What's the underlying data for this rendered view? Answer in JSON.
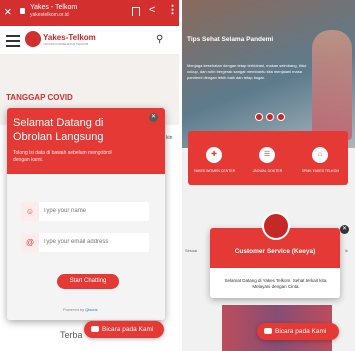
{
  "left": {
    "browser": {
      "close": "×",
      "title": "Yakes - Telkom",
      "url": "yakestelkom.or.id",
      "share": "<",
      "menu": "⋮"
    },
    "site": {
      "logo_text": "Yakes-Telkom",
      "logo_sub": "YAYASAN KESEHATAN TELKOM",
      "search": "⚲"
    },
    "hero": {
      "title": "TANGGAP COVID",
      "side": "kin"
    },
    "chat": {
      "title": "Selamat Datang di Obrolan Langsung",
      "subtitle": "Tolong isi data di bawah sebelum mengobrol dengan kami.",
      "close": "✕",
      "name_placeholder": "Type your name",
      "email_placeholder": "Type your email address",
      "start_button": "Start Chatting",
      "powered_prefix": "Powered by",
      "powered_brand": "Qiscus"
    },
    "page_word": "Terba",
    "float_button": "Bicara pada Kami"
  },
  "right": {
    "slide_title": "Tips Sehat Selama Pandemi",
    "slide_text": "Menjaga kesehatan dengan tetap terhidrasi, makan seimbang, tidur cukup, dan rutin bergerak sangat membantu kita menjalani masa pandemi dengan lebih baik dan tetap bugar.",
    "services": [
      {
        "icon": "✚",
        "label": "YAKES WOMEN CENTER"
      },
      {
        "icon": "☰",
        "label": "JADWAL DOKTER"
      },
      {
        "icon": "⌂",
        "label": "SPMK YAKES TELKOM"
      }
    ],
    "side_left": "Sesuai",
    "side_right": "ik",
    "cs_title": "Customer Service (Keeya)",
    "cs_message": "Selamat Datang di Yakes Telkom. Sehat terkait kita, Melayani dengan Cinta.",
    "cs_close": "✕",
    "float_button": "Bicara pada Kami"
  },
  "colors": {
    "brand_red": "#e53935",
    "dark_red": "#c62828"
  }
}
